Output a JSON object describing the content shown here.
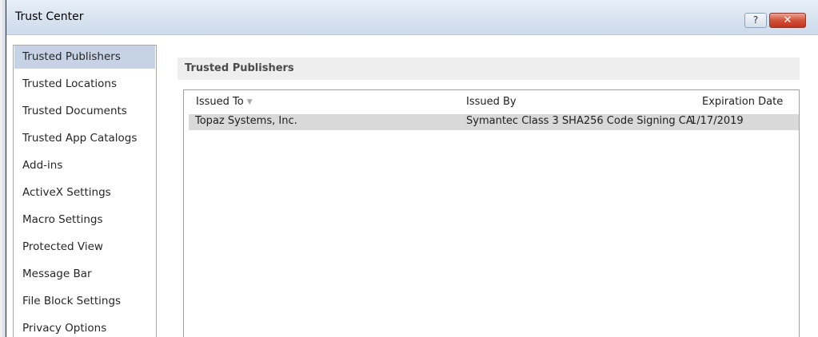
{
  "window": {
    "title": "Trust Center"
  },
  "title_buttons": {
    "help": "?",
    "close": "✕"
  },
  "sidebar": {
    "items": [
      {
        "label": "Trusted Publishers",
        "selected": true
      },
      {
        "label": "Trusted Locations"
      },
      {
        "label": "Trusted Documents"
      },
      {
        "label": "Trusted App Catalogs"
      },
      {
        "label": "Add-ins"
      },
      {
        "label": "ActiveX Settings"
      },
      {
        "label": "Macro Settings"
      },
      {
        "label": "Protected View"
      },
      {
        "label": "Message Bar"
      },
      {
        "label": "File Block Settings"
      },
      {
        "label": "Privacy Options"
      }
    ]
  },
  "main": {
    "section_title": "Trusted Publishers",
    "table": {
      "columns": [
        "Issued To",
        "Issued By",
        "Expiration Date"
      ],
      "sort_icon": "sort-down-arrow",
      "rows": [
        {
          "issued_to": "Topaz Systems, Inc.",
          "issued_by": "Symantec Class 3 SHA256 Code Signing CA",
          "expiration": "1/17/2019",
          "selected": true
        }
      ]
    }
  },
  "colors": {
    "sidebar_selected": "#c6d3e6",
    "row_selected": "#d9d9d9",
    "close_button": "#c1341d",
    "titlebar": "#d9e4f1"
  }
}
